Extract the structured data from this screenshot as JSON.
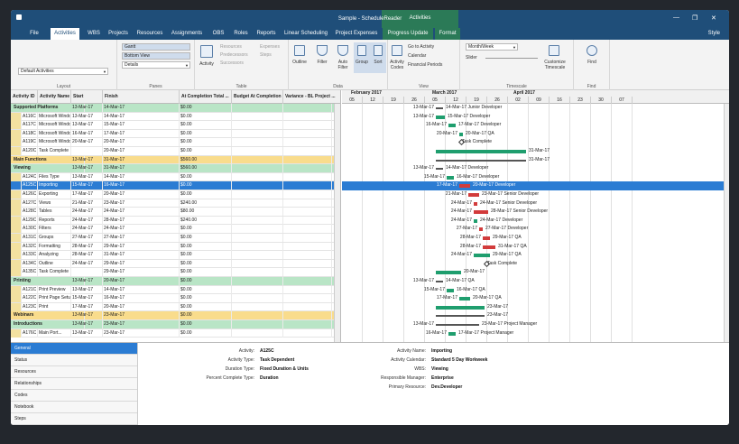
{
  "window": {
    "title": "Sample - ScheduleReader",
    "context_tab": "Activities",
    "style_label": "Style"
  },
  "menu": {
    "tabs": [
      "File",
      "Activities",
      "WBS",
      "Projects",
      "Resources",
      "Assignments",
      "OBS",
      "Roles",
      "Reports",
      "Linear Scheduling",
      "Project Expenses",
      "Progress Update",
      "Format"
    ]
  },
  "ribbon": {
    "layout": {
      "select": "Default Activities",
      "label": "Layout"
    },
    "panes": {
      "gantt": "Gantt",
      "bottom_view": "Bottom View",
      "details": "Details",
      "label": "Panes"
    },
    "table": {
      "activity": "Activity",
      "resources": "Resources",
      "predecessors": "Predecessors",
      "successors": "Successors",
      "expenses": "Expenses",
      "steps": "Steps",
      "label": "Table"
    },
    "data": {
      "outline": "Outline",
      "filter": "Filter",
      "auto_filter": "Auto Filter",
      "group": "Group",
      "sort": "Sort",
      "label": "Data"
    },
    "view": {
      "activity_codes": "Activity Codes",
      "goto": "Go to Activity",
      "calendar": "Calendar",
      "financial": "Financial Periods",
      "label": "View"
    },
    "timescale": {
      "select": "Month/Week",
      "slider": "Slider",
      "customize": "Customize Timescale",
      "label": "Timescale"
    },
    "find": {
      "find": "Find",
      "label": "Find"
    }
  },
  "table": {
    "headers": [
      "Activity ID",
      "Activity Name",
      "Start",
      "Finish",
      "At Completion Total ...",
      "Budget At Completion",
      "Variance - BL Project ..."
    ],
    "rows": [
      {
        "t": "g",
        "id": "",
        "name": "Supported Platforms",
        "start": "13-Mar-17",
        "finish": "14-Mar-17",
        "total": "$0.00",
        "grp": true
      },
      {
        "t": "",
        "id": "A116C",
        "name": "Microsoft Windows",
        "start": "13-Mar-17",
        "finish": "14-Mar-17",
        "total": "$0.00"
      },
      {
        "t": "",
        "id": "A117C",
        "name": "Microsoft Windows",
        "start": "13-Mar-17",
        "finish": "15-Mar-17",
        "total": "$0.00"
      },
      {
        "t": "",
        "id": "A118C",
        "name": "Microsoft Windows",
        "start": "16-Mar-17",
        "finish": "17-Mar-17",
        "total": "$0.00"
      },
      {
        "t": "",
        "id": "A119C",
        "name": "Microsoft Windows",
        "start": "20-Mar-17",
        "finish": "20-Mar-17",
        "total": "$0.00"
      },
      {
        "t": "",
        "id": "A120C",
        "name": "Task Complete",
        "start": "",
        "finish": "20-Mar-17",
        "total": "$0.00"
      },
      {
        "t": "y",
        "id": "",
        "name": "Main Functions",
        "start": "13-Mar-17",
        "finish": "31-Mar-17",
        "total": "$560.00",
        "grp": true
      },
      {
        "t": "g",
        "id": "",
        "name": "Viewing",
        "start": "13-Mar-17",
        "finish": "31-Mar-17",
        "total": "$560.00",
        "grp": true
      },
      {
        "t": "",
        "id": "A124C",
        "name": "Files Type",
        "start": "13-Mar-17",
        "finish": "14-Mar-17",
        "total": "$0.00"
      },
      {
        "t": "s",
        "id": "A125C",
        "name": "Importing",
        "start": "15-Mar-17",
        "finish": "16-Mar-17",
        "total": "$0.00"
      },
      {
        "t": "",
        "id": "A126C",
        "name": "Exporting",
        "start": "17-Mar-17",
        "finish": "20-Mar-17",
        "total": "$0.00"
      },
      {
        "t": "",
        "id": "A127C",
        "name": "Views",
        "start": "21-Mar-17",
        "finish": "23-Mar-17",
        "total": "$240.00"
      },
      {
        "t": "",
        "id": "A128C",
        "name": "Tables",
        "start": "24-Mar-17",
        "finish": "24-Mar-17",
        "total": "$80.00"
      },
      {
        "t": "",
        "id": "A129C",
        "name": "Reports",
        "start": "24-Mar-17",
        "finish": "28-Mar-17",
        "total": "$240.00"
      },
      {
        "t": "",
        "id": "A130C",
        "name": "Filters",
        "start": "24-Mar-17",
        "finish": "24-Mar-17",
        "total": "$0.00"
      },
      {
        "t": "",
        "id": "A131C",
        "name": "Groups",
        "start": "27-Mar-17",
        "finish": "27-Mar-17",
        "total": "$0.00"
      },
      {
        "t": "",
        "id": "A132C",
        "name": "Formatting",
        "start": "28-Mar-17",
        "finish": "29-Mar-17",
        "total": "$0.00"
      },
      {
        "t": "",
        "id": "A133C",
        "name": "Analyzing",
        "start": "28-Mar-17",
        "finish": "31-Mar-17",
        "total": "$0.00"
      },
      {
        "t": "",
        "id": "A134C",
        "name": "Outline",
        "start": "24-Mar-17",
        "finish": "29-Mar-17",
        "total": "$0.00"
      },
      {
        "t": "",
        "id": "A135C",
        "name": "Task Complete",
        "start": "",
        "finish": "29-Mar-17",
        "total": "$0.00"
      },
      {
        "t": "g",
        "id": "",
        "name": "Printing",
        "start": "13-Mar-17",
        "finish": "20-Mar-17",
        "total": "$0.00",
        "grp": true
      },
      {
        "t": "",
        "id": "A121C",
        "name": "Print Preview",
        "start": "13-Mar-17",
        "finish": "14-Mar-17",
        "total": "$0.00"
      },
      {
        "t": "",
        "id": "A122C",
        "name": "Print Page Setup",
        "start": "15-Mar-17",
        "finish": "16-Mar-17",
        "total": "$0.00"
      },
      {
        "t": "",
        "id": "A123C",
        "name": "Print",
        "start": "17-Mar-17",
        "finish": "20-Mar-17",
        "total": "$0.00"
      },
      {
        "t": "y",
        "id": "",
        "name": "Webinars",
        "start": "13-Mar-17",
        "finish": "23-Mar-17",
        "total": "$0.00",
        "grp": true
      },
      {
        "t": "g",
        "id": "",
        "name": "Introductions",
        "start": "13-Mar-17",
        "finish": "23-Mar-17",
        "total": "$0.00",
        "grp": true
      },
      {
        "t": "",
        "id": "A176C",
        "name": "Main Port...",
        "start": "13-Mar-17",
        "finish": "23-Mar-17",
        "total": "$0.00"
      }
    ]
  },
  "gantt": {
    "months": [
      "February 2017",
      "March 2017",
      "April 2017"
    ],
    "days": [
      "05",
      "12",
      "19",
      "26",
      "05",
      "12",
      "19",
      "26",
      "02",
      "09",
      "16",
      "23",
      "30",
      "07"
    ],
    "labels": [
      {
        "l": "13-Mar-17",
        "r": "14-Mar-17  Junior Developer"
      },
      {
        "l": "13-Mar-17",
        "r": "15-Mar-17  Developer"
      },
      {
        "l": "16-Mar-17",
        "r": "17-Mar-17  Developer"
      },
      {
        "l": "20-Mar-17",
        "r": "20-Mar-17  QA"
      },
      {
        "l": "",
        "r": "Task Complete"
      },
      {
        "l": "",
        "r": "31-Mar-17"
      },
      {
        "l": "",
        "r": "31-Mar-17"
      },
      {
        "l": "13-Mar-17",
        "r": "14-Mar-17  Developer"
      },
      {
        "l": "15-Mar-17",
        "r": "16-Mar-17  Developer"
      },
      {
        "l": "17-Mar-17",
        "r": "20-Mar-17  Developer"
      },
      {
        "l": "21-Mar-17",
        "r": "23-Mar-17  Senior Developer"
      },
      {
        "l": "24-Mar-17",
        "r": "24-Mar-17  Senior Developer"
      },
      {
        "l": "24-Mar-17",
        "r": "28-Mar-17  Senior Developer"
      },
      {
        "l": "24-Mar-17",
        "r": "24-Mar-17  Developer"
      },
      {
        "l": "27-Mar-17",
        "r": "27-Mar-17  Developer"
      },
      {
        "l": "28-Mar-17",
        "r": "29-Mar-17  QA"
      },
      {
        "l": "28-Mar-17",
        "r": "31-Mar-17  QA"
      },
      {
        "l": "24-Mar-17",
        "r": "29-Mar-17  QA"
      },
      {
        "l": "",
        "r": "Task Complete"
      },
      {
        "l": "",
        "r": "20-Mar-17"
      },
      {
        "l": "13-Mar-17",
        "r": "14-Mar-17  QA"
      },
      {
        "l": "15-Mar-17",
        "r": "16-Mar-17  QA"
      },
      {
        "l": "17-Mar-17",
        "r": "20-Mar-17  QA"
      },
      {
        "l": "",
        "r": "23-Mar-17"
      },
      {
        "l": "",
        "r": "23-Mar-17"
      },
      {
        "l": "13-Mar-17",
        "r": "23-Mar-17  Project Manager"
      },
      {
        "l": "16-Mar-17",
        "r": "17-Mar-17  Project Manager"
      }
    ]
  },
  "details": {
    "tabs": [
      "General",
      "Status",
      "Resources",
      "Relationships",
      "Codes",
      "Notebook",
      "Steps"
    ],
    "left": [
      {
        "label": "Activity:",
        "value": "A125C"
      },
      {
        "label": "Activity Type:",
        "value": "Task Dependent"
      },
      {
        "label": "Duration Type:",
        "value": "Fixed Duration & Units"
      },
      {
        "label": "Percent Complete Type:",
        "value": "Duration"
      }
    ],
    "right": [
      {
        "label": "Activity Name:",
        "value": "Importing"
      },
      {
        "label": "Activity Calendar:",
        "value": "Standard 5 Day Workweek"
      },
      {
        "label": "WBS:",
        "value": "Viewing"
      },
      {
        "label": "Responsible Manager:",
        "value": "Enterprise"
      },
      {
        "label": "Primary Resource:",
        "value": "Dev.Developer"
      }
    ]
  },
  "colors": {
    "titlebar": "#1f4e79",
    "context": "#2b7a57",
    "selected": "#2b7cd3",
    "group_yellow": "#f9dc8c",
    "group_green": "#b9e5c6",
    "bar_green": "#1f9e6e",
    "bar_red": "#d23b3b"
  }
}
